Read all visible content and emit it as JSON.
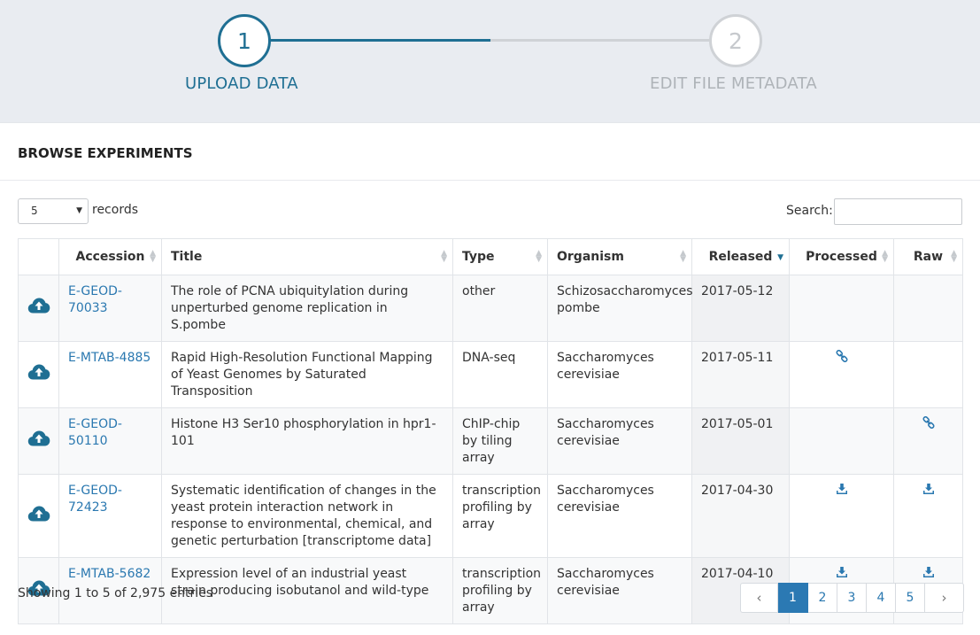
{
  "stepper": {
    "steps": [
      {
        "number": "1",
        "label": "UPLOAD DATA"
      },
      {
        "number": "2",
        "label": "EDIT FILE METADATA"
      }
    ]
  },
  "section": {
    "title": "BROWSE EXPERIMENTS"
  },
  "controls": {
    "length_value": "5",
    "records_label": "records",
    "search_label": "Search:",
    "search_value": ""
  },
  "table": {
    "headers": {
      "accession": "Accession",
      "title": "Title",
      "type": "Type",
      "organism": "Organism",
      "released": "Released",
      "processed": "Processed",
      "raw": "Raw"
    },
    "rows": [
      {
        "accession": "E-GEOD-70033",
        "title": "The role of PCNA ubiquitylation during unperturbed genome replication in S.pombe",
        "type": "other",
        "organism": "Schizosaccharomyces pombe",
        "released": "2017-05-12",
        "processed": "",
        "raw": ""
      },
      {
        "accession": "E-MTAB-4885",
        "title": "Rapid High-Resolution Functional Mapping of Yeast Genomes by Saturated Transposition",
        "type": "DNA-seq",
        "organism": "Saccharomyces cerevisiae",
        "released": "2017-05-11",
        "processed": "link-icon",
        "raw": ""
      },
      {
        "accession": "E-GEOD-50110",
        "title": "Histone H3 Ser10 phosphorylation in hpr1-101",
        "type": "ChIP-chip by tiling array",
        "organism": "Saccharomyces cerevisiae",
        "released": "2017-05-01",
        "processed": "",
        "raw": "link-icon"
      },
      {
        "accession": "E-GEOD-72423",
        "title": "Systematic identification of changes in the yeast protein interaction network in response to environmental, chemical, and genetic perturbation [transcriptome data]",
        "type": "transcription profiling by array",
        "organism": "Saccharomyces cerevisiae",
        "released": "2017-04-30",
        "processed": "download-icon",
        "raw": "download-icon"
      },
      {
        "accession": "E-MTAB-5682",
        "title": "Expression level of an industrial yeast strain producing isobutanol and wild-type",
        "type": "transcription profiling by array",
        "organism": "Saccharomyces cerevisiae",
        "released": "2017-04-10",
        "processed": "download-icon",
        "raw": "download-icon"
      }
    ]
  },
  "footer": {
    "info": "Showing 1 to 5 of 2,975 entries",
    "pagination": {
      "prev": "‹",
      "pages": [
        "1",
        "2",
        "3",
        "4",
        "5"
      ],
      "active": "1",
      "next": "›"
    }
  },
  "colors": {
    "accent": "#1f6f93",
    "link": "#2a78b0",
    "active_page": "#2b79b3"
  }
}
